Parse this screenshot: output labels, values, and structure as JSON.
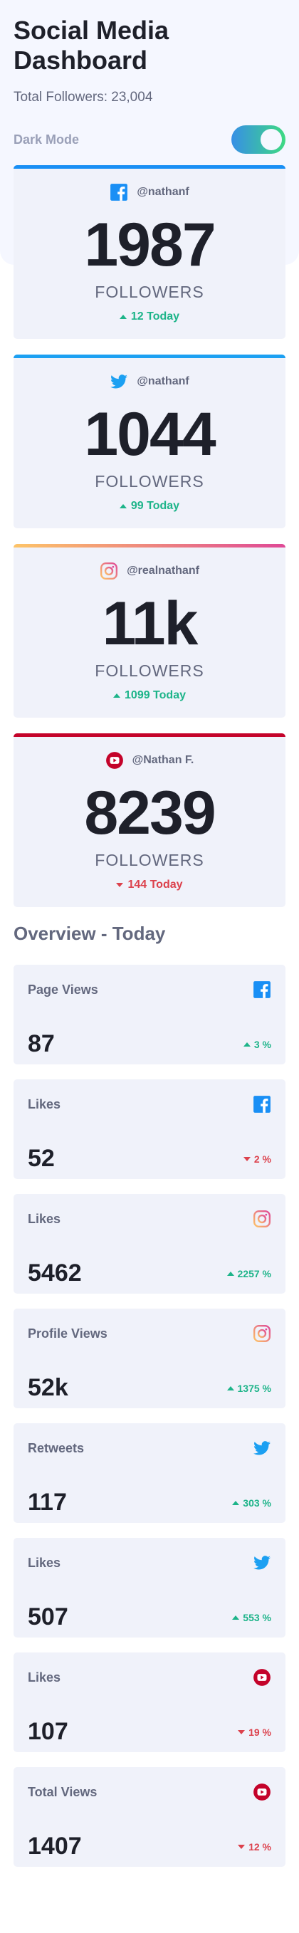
{
  "header": {
    "title": "Social Media Dashboard",
    "total_followers": "Total Followers: 23,004",
    "dark_mode_label": "Dark Mode",
    "dark_mode_on": true
  },
  "colors": {
    "facebook": "#198ff5",
    "twitter": "#1ca0f2",
    "instagram_start": "#fdc468",
    "instagram_end": "#df4996",
    "youtube": "#c4032a",
    "up": "#1db489",
    "down": "#dc414c",
    "toggle_start": "#378fe6",
    "toggle_end": "#3eda82"
  },
  "followers_label": "FOLLOWERS",
  "cards": [
    {
      "network": "facebook",
      "icon": "facebook-icon",
      "handle": "@nathanf",
      "count": "1987",
      "delta": "12 Today",
      "direction": "up"
    },
    {
      "network": "twitter",
      "icon": "twitter-icon",
      "handle": "@nathanf",
      "count": "1044",
      "delta": "99 Today",
      "direction": "up"
    },
    {
      "network": "instagram",
      "icon": "instagram-icon",
      "handle": "@realnathanf",
      "count": "11k",
      "delta": "1099 Today",
      "direction": "up"
    },
    {
      "network": "youtube",
      "icon": "youtube-icon",
      "handle": "@Nathan F.",
      "count": "8239",
      "delta": "144 Today",
      "direction": "down"
    }
  ],
  "overview": {
    "title": "Overview - Today",
    "items": [
      {
        "label": "Page Views",
        "network": "facebook",
        "icon": "facebook-icon",
        "value": "87",
        "delta": "3 %",
        "direction": "up"
      },
      {
        "label": "Likes",
        "network": "facebook",
        "icon": "facebook-icon",
        "value": "52",
        "delta": "2 %",
        "direction": "down"
      },
      {
        "label": "Likes",
        "network": "instagram",
        "icon": "instagram-icon",
        "value": "5462",
        "delta": "2257 %",
        "direction": "up"
      },
      {
        "label": "Profile Views",
        "network": "instagram",
        "icon": "instagram-icon",
        "value": "52k",
        "delta": "1375 %",
        "direction": "up"
      },
      {
        "label": "Retweets",
        "network": "twitter",
        "icon": "twitter-icon",
        "value": "117",
        "delta": "303 %",
        "direction": "up"
      },
      {
        "label": "Likes",
        "network": "twitter",
        "icon": "twitter-icon",
        "value": "507",
        "delta": "553 %",
        "direction": "up"
      },
      {
        "label": "Likes",
        "network": "youtube",
        "icon": "youtube-icon",
        "value": "107",
        "delta": "19 %",
        "direction": "down"
      },
      {
        "label": "Total Views",
        "network": "youtube",
        "icon": "youtube-icon",
        "value": "1407",
        "delta": "12 %",
        "direction": "down"
      }
    ]
  }
}
